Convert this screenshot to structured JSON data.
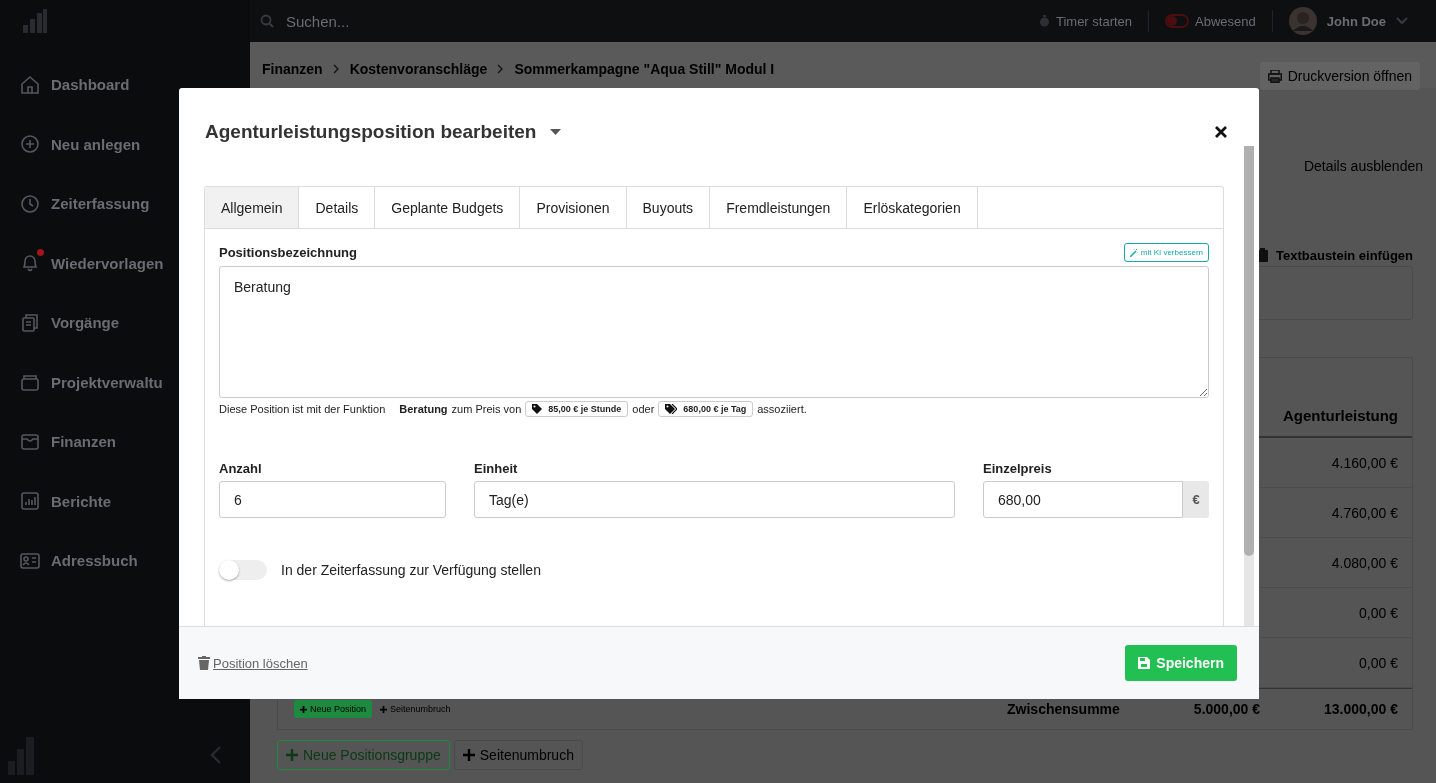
{
  "topbar": {
    "search_placeholder": "Suchen...",
    "timer": "Timer starten",
    "status": "Abwesend",
    "user": "John Doe"
  },
  "sidebar": {
    "items": [
      {
        "label": "Dashboard",
        "notification": false
      },
      {
        "label": "Neu anlegen",
        "notification": false
      },
      {
        "label": "Zeiterfassung",
        "notification": false
      },
      {
        "label": "Wiedervorlagen",
        "notification": true
      },
      {
        "label": "Vorgänge",
        "notification": false
      },
      {
        "label": "Projektverwaltu",
        "notification": false
      },
      {
        "label": "Finanzen",
        "notification": false
      },
      {
        "label": "Berichte",
        "notification": false
      },
      {
        "label": "Adressbuch",
        "notification": false
      }
    ]
  },
  "breadcrumb": [
    "Finanzen",
    "Kostenvoranschläge",
    "Sommerkampagne \"Aqua Still\" Modul I"
  ],
  "print_button": "Druckversion öffnen",
  "details_toggle": "Details ausblenden",
  "text_block_button": "Textbaustein einfügen",
  "table": {
    "column": "Agenturleistung",
    "values": [
      "4.160,00 €",
      "4.760,00 €",
      "4.080,00 €",
      "0,00 €",
      "0,00 €"
    ],
    "subtotal_label": "Zwischensumme",
    "subtotal_values": [
      "5.000,00 €",
      "13.000,00 €"
    ]
  },
  "group_buttons": [
    "Neue Position",
    "Seitenumbruch"
  ],
  "bottom_buttons": [
    "Neue Positionsgruppe",
    "Seitenumbruch"
  ],
  "modal": {
    "title": "Agenturleistungsposition bearbeiten",
    "tabs": [
      {
        "label": "Allgemein",
        "selected": true
      },
      {
        "label": "Details",
        "selected": false
      },
      {
        "label": "Geplante Budgets",
        "selected": false
      },
      {
        "label": "Provisionen",
        "selected": false
      },
      {
        "label": "Buyouts",
        "selected": false
      },
      {
        "label": "Fremdleistungen",
        "selected": false
      },
      {
        "label": "Erlöskategorien",
        "selected": false
      }
    ],
    "description_label": "Positionsbezeichnung",
    "ai_button": "mit KI verbessern",
    "description": "Beratung",
    "hint": {
      "prefix": "Diese Position ist mit der Funktion",
      "function": "Beratung",
      "price_text": "zum Preis von",
      "tag_1": "85,00 € je Stunde",
      "or": "oder",
      "tag_2": "680,00 € je Tag",
      "suffix": "assoziiert."
    },
    "fields": {
      "count_label": "Anzahl",
      "count": "6",
      "unit_label": "Einheit",
      "unit": "Tag(e)",
      "price_label": "Einzelpreis",
      "price": "680,00",
      "currency": "€"
    },
    "time_tracking": {
      "label": "In der Zeiterfassung zur Verfügung stellen",
      "on": false
    },
    "delete_link": "Position löschen",
    "save_button": "Speichern"
  }
}
